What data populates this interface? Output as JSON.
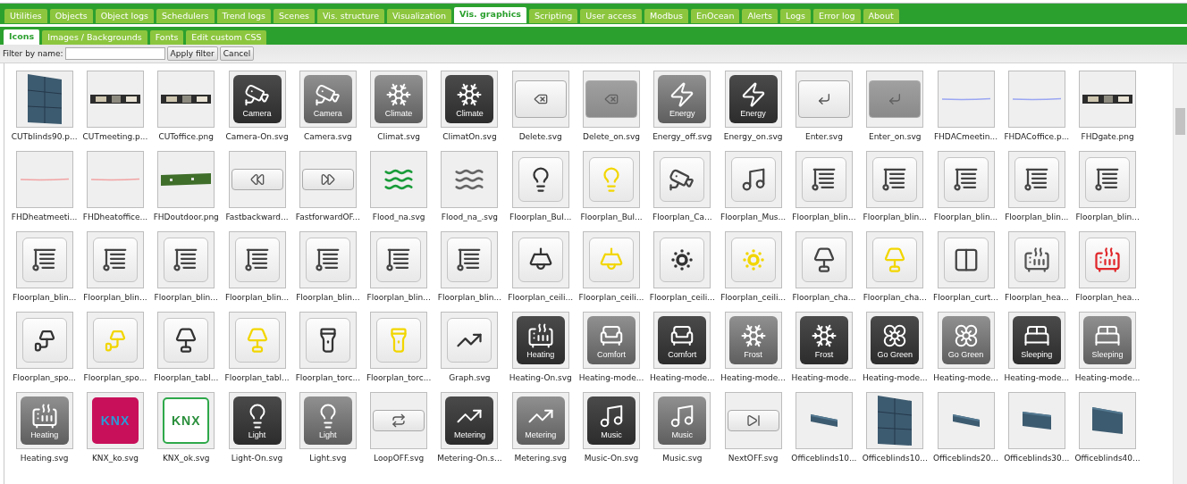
{
  "main_tabs": [
    {
      "label": "Utilities",
      "selected": false
    },
    {
      "label": "Objects",
      "selected": false
    },
    {
      "label": "Object logs",
      "selected": false
    },
    {
      "label": "Schedulers",
      "selected": false
    },
    {
      "label": "Trend logs",
      "selected": false
    },
    {
      "label": "Scenes",
      "selected": false
    },
    {
      "label": "Vis. structure",
      "selected": false
    },
    {
      "label": "Visualization",
      "selected": false
    },
    {
      "label": "Vis. graphics",
      "selected": true
    },
    {
      "label": "Scripting",
      "selected": false
    },
    {
      "label": "User access",
      "selected": false
    },
    {
      "label": "Modbus",
      "selected": false
    },
    {
      "label": "EnOcean",
      "selected": false
    },
    {
      "label": "Alerts",
      "selected": false
    },
    {
      "label": "Logs",
      "selected": false
    },
    {
      "label": "Error log",
      "selected": false
    },
    {
      "label": "About",
      "selected": false
    }
  ],
  "sub_tabs": [
    {
      "label": "Icons",
      "selected": true
    },
    {
      "label": "Images / Backgrounds",
      "selected": false
    },
    {
      "label": "Fonts",
      "selected": false
    },
    {
      "label": "Edit custom CSS",
      "selected": false
    }
  ],
  "filter": {
    "label": "Filter by name:",
    "apply": "Apply filter",
    "cancel": "Cancel"
  },
  "icons": [
    {
      "label": "CUTblinds90.p...",
      "kind": "picture-blind"
    },
    {
      "label": "CUTmeeting.p...",
      "kind": "picture-strip"
    },
    {
      "label": "CUToffice.png",
      "kind": "picture-strip"
    },
    {
      "label": "Camera-On.svg",
      "kind": "dark-camera",
      "caption": "Camera"
    },
    {
      "label": "Camera.svg",
      "kind": "grey-camera",
      "caption": "Camera"
    },
    {
      "label": "Climat.svg",
      "kind": "grey-snowflake",
      "caption": "Climate"
    },
    {
      "label": "ClimatOn.svg",
      "kind": "dark-snowflake",
      "caption": "Climate"
    },
    {
      "label": "Delete.svg",
      "kind": "button-delete"
    },
    {
      "label": "Delete_on.svg",
      "kind": "dim-delete"
    },
    {
      "label": "Energy_off.svg",
      "kind": "grey-energy",
      "caption": "Energy"
    },
    {
      "label": "Energy_on.svg",
      "kind": "dark-energy",
      "caption": "Energy"
    },
    {
      "label": "Enter.svg",
      "kind": "button-enter"
    },
    {
      "label": "Enter_on.svg",
      "kind": "dim-enter"
    },
    {
      "label": "FHDACmeetin...",
      "kind": "line",
      "color": "#9aa6f2"
    },
    {
      "label": "FHDACoffice.p...",
      "kind": "line",
      "color": "#9aa6f2"
    },
    {
      "label": "FHDgate.png",
      "kind": "picture-strip"
    },
    {
      "label": "FHDheatmeeti...",
      "kind": "line",
      "color": "#f2a3a3"
    },
    {
      "label": "FHDheatoffice...",
      "kind": "line",
      "color": "#f2a3a3"
    },
    {
      "label": "FHDoutdoor.png",
      "kind": "picture-grass"
    },
    {
      "label": "Fastbackward...",
      "kind": "button-rewind"
    },
    {
      "label": "FastforwardOF...",
      "kind": "button-forward"
    },
    {
      "label": "Flood_na.svg",
      "kind": "plain-flood",
      "color": "#1a9c3a"
    },
    {
      "label": "Flood_na_.svg",
      "kind": "plain-flood",
      "color": "#666666"
    },
    {
      "label": "Floorplan_Bul...",
      "kind": "rounded-bulb",
      "color": "#333333"
    },
    {
      "label": "Floorplan_Bul...",
      "kind": "rounded-bulb",
      "color": "#f2d600"
    },
    {
      "label": "Floorplan_Ca...",
      "kind": "rounded-camera",
      "color": "#444444"
    },
    {
      "label": "Floorplan_Mus...",
      "kind": "rounded-music",
      "color": "#444444"
    },
    {
      "label": "Floorplan_blin...",
      "kind": "rounded-blinds",
      "color": "#444444"
    },
    {
      "label": "Floorplan_blin...",
      "kind": "rounded-blinds",
      "color": "#444444"
    },
    {
      "label": "Floorplan_blin...",
      "kind": "rounded-blinds",
      "color": "#444444"
    },
    {
      "label": "Floorplan_blin...",
      "kind": "rounded-blinds",
      "color": "#444444"
    },
    {
      "label": "Floorplan_blin...",
      "kind": "rounded-blinds",
      "color": "#444444"
    },
    {
      "label": "Floorplan_blin...",
      "kind": "rounded-blinds",
      "color": "#444444"
    },
    {
      "label": "Floorplan_blin...",
      "kind": "rounded-blinds",
      "color": "#444444"
    },
    {
      "label": "Floorplan_blin...",
      "kind": "rounded-blinds",
      "color": "#444444"
    },
    {
      "label": "Floorplan_blin...",
      "kind": "rounded-blinds",
      "color": "#444444"
    },
    {
      "label": "Floorplan_blin...",
      "kind": "rounded-blinds",
      "color": "#444444"
    },
    {
      "label": "Floorplan_blin...",
      "kind": "rounded-blinds",
      "color": "#444444"
    },
    {
      "label": "Floorplan_blin...",
      "kind": "rounded-blinds",
      "color": "#444444"
    },
    {
      "label": "Floorplan_ceili...",
      "kind": "rounded-ceiling",
      "color": "#333333"
    },
    {
      "label": "Floorplan_ceili...",
      "kind": "rounded-ceiling",
      "color": "#f2d600"
    },
    {
      "label": "Floorplan_ceili...",
      "kind": "rounded-spots",
      "color": "#333333"
    },
    {
      "label": "Floorplan_ceili...",
      "kind": "rounded-spots",
      "color": "#f2d600"
    },
    {
      "label": "Floorplan_cha...",
      "kind": "rounded-chandelier",
      "color": "#444444"
    },
    {
      "label": "Floorplan_cha...",
      "kind": "rounded-chandelier",
      "color": "#f2d600"
    },
    {
      "label": "Floorplan_curt...",
      "kind": "rounded-curtain",
      "color": "#444444"
    },
    {
      "label": "Floorplan_hea...",
      "kind": "rounded-heating",
      "color": "#555555"
    },
    {
      "label": "Floorplan_hea...",
      "kind": "rounded-heating",
      "color": "#e0262a"
    },
    {
      "label": "Floorplan_spo...",
      "kind": "rounded-spot",
      "color": "#333333"
    },
    {
      "label": "Floorplan_spo...",
      "kind": "rounded-spot",
      "color": "#f2d600"
    },
    {
      "label": "Floorplan_tabl...",
      "kind": "rounded-table",
      "color": "#333333"
    },
    {
      "label": "Floorplan_tabl...",
      "kind": "rounded-table",
      "color": "#f2d600"
    },
    {
      "label": "Floorplan_torc...",
      "kind": "rounded-torch",
      "color": "#333333"
    },
    {
      "label": "Floorplan_torc...",
      "kind": "rounded-torch",
      "color": "#f2d600"
    },
    {
      "label": "Graph.svg",
      "kind": "rounded-graph",
      "color": "#333333"
    },
    {
      "label": "Heating-On.svg",
      "kind": "dark-heating",
      "caption": "Heating"
    },
    {
      "label": "Heating-mode...",
      "kind": "grey-comfort",
      "caption": "Comfort"
    },
    {
      "label": "Heating-mode...",
      "kind": "dark-comfort",
      "caption": "Comfort"
    },
    {
      "label": "Heating-mode...",
      "kind": "grey-snowflake",
      "caption": "Frost"
    },
    {
      "label": "Heating-mode...",
      "kind": "dark-snowflake",
      "caption": "Frost"
    },
    {
      "label": "Heating-mode...",
      "kind": "dark-flower",
      "caption": "Go Green"
    },
    {
      "label": "Heating-mode...",
      "kind": "grey-flower",
      "caption": "Go Green"
    },
    {
      "label": "Heating-mode...",
      "kind": "dark-sleeping",
      "caption": "Sleeping"
    },
    {
      "label": "Heating-mode...",
      "kind": "grey-sleeping",
      "caption": "Sleeping"
    },
    {
      "label": "Heating.svg",
      "kind": "grey-heating",
      "caption": "Heating"
    },
    {
      "label": "KNX_ko.svg",
      "kind": "knx",
      "caption": "KNX",
      "color": "#c8105a"
    },
    {
      "label": "KNX_ok.svg",
      "kind": "knx",
      "caption": "KNX",
      "color": "#2ea84a"
    },
    {
      "label": "Light-On.svg",
      "kind": "dark-bulb",
      "caption": "Light"
    },
    {
      "label": "Light.svg",
      "kind": "grey-bulb",
      "caption": "Light"
    },
    {
      "label": "LoopOFF.svg",
      "kind": "button-loop"
    },
    {
      "label": "Metering-On.s...",
      "kind": "dark-graph",
      "caption": "Metering"
    },
    {
      "label": "Metering.svg",
      "kind": "grey-graph",
      "caption": "Metering"
    },
    {
      "label": "Music-On.svg",
      "kind": "dark-music",
      "caption": "Music"
    },
    {
      "label": "Music.svg",
      "kind": "grey-music",
      "caption": "Music"
    },
    {
      "label": "NextOFF.svg",
      "kind": "button-next"
    },
    {
      "label": "Officeblinds10...",
      "kind": "picture-slat"
    },
    {
      "label": "Officeblinds10...",
      "kind": "picture-blind"
    },
    {
      "label": "Officeblinds20...",
      "kind": "picture-slat"
    },
    {
      "label": "Officeblinds30...",
      "kind": "picture-slat2"
    },
    {
      "label": "Officeblinds40...",
      "kind": "picture-slat3"
    }
  ]
}
